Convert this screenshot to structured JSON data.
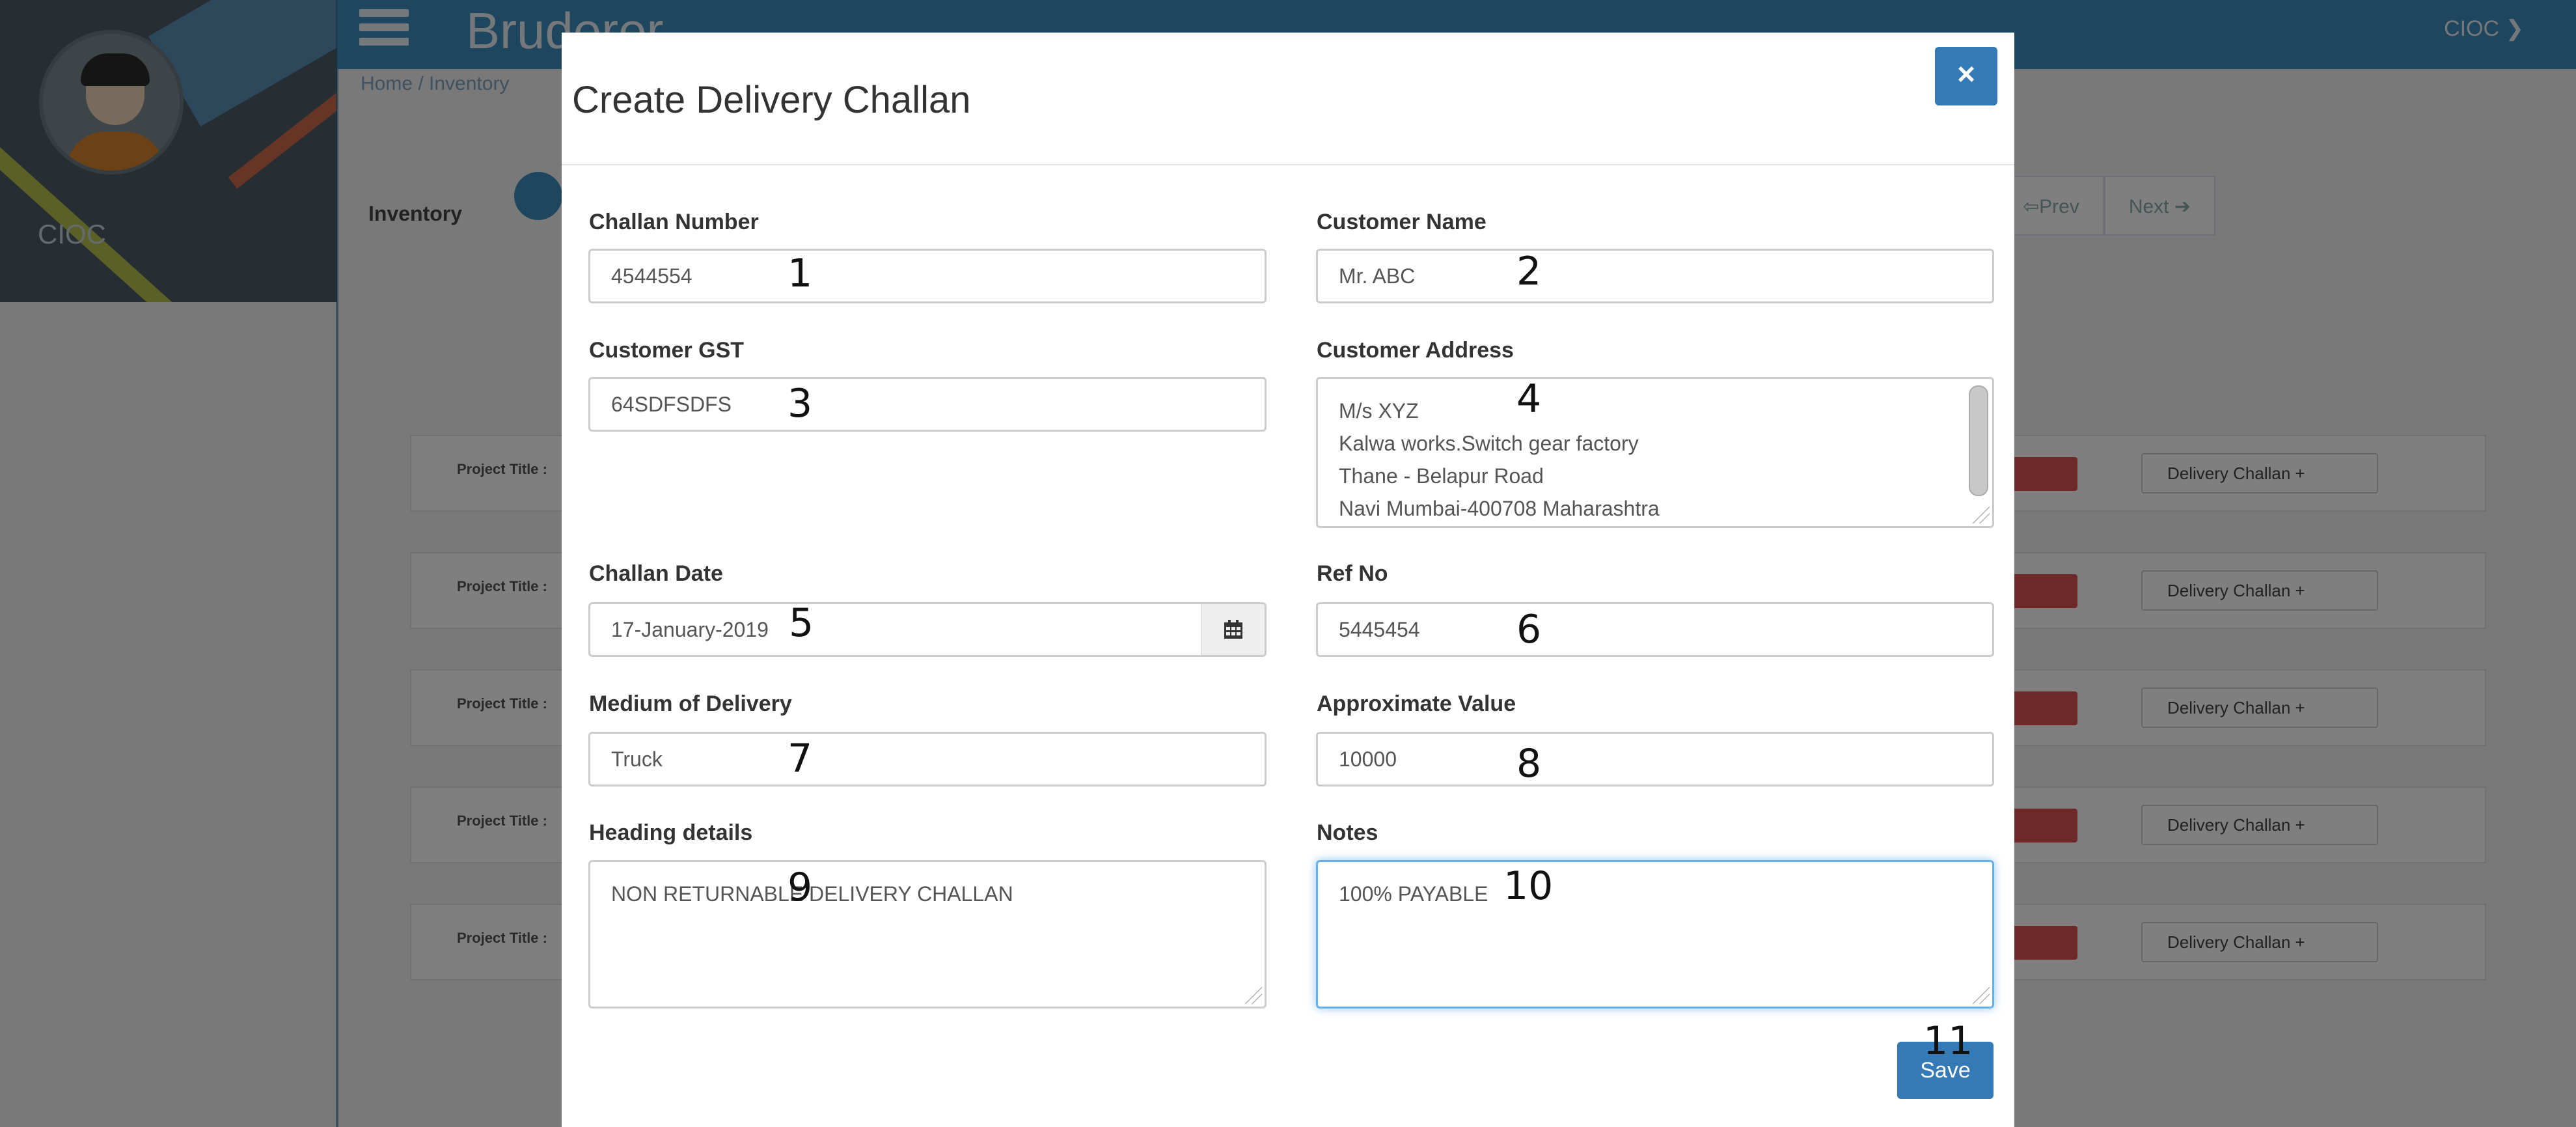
{
  "app": {
    "brand": "Bruderer",
    "user_menu": "CIOC ❯",
    "profile_name": "CIOC",
    "breadcrumb": "Home  /  Inventory",
    "inventory_label": "Inventory",
    "pager": {
      "prev": "⇦Prev",
      "next": "Next ➔"
    },
    "project_cards": [
      {
        "title": "Project Title :",
        "button": "Delivery Challan  +"
      },
      {
        "title": "Project Title :",
        "button": "Delivery Challan  +"
      },
      {
        "title": "Project Title :",
        "button": "Delivery Challan  +"
      },
      {
        "title": "Project Title :",
        "button": "Delivery Challan  +"
      },
      {
        "title": "Project Title :",
        "button": "Delivery Challan  +"
      }
    ]
  },
  "modal": {
    "title": "Create Delivery Challan",
    "close_label": "×",
    "fields": {
      "challan_number": {
        "label": "Challan Number",
        "value": "4544554"
      },
      "customer_name": {
        "label": "Customer Name",
        "value": "Mr. ABC"
      },
      "customer_gst": {
        "label": "Customer GST",
        "value": "64SDFSDFS"
      },
      "customer_address": {
        "label": "Customer Address",
        "lines": [
          "M/s XYZ",
          "Kalwa works.Switch gear factory",
          "Thane - Belapur Road",
          "Navi Mumbai-400708 Maharashtra"
        ]
      },
      "challan_date": {
        "label": "Challan Date",
        "value": "17-January-2019"
      },
      "ref_no": {
        "label": "Ref No",
        "value": "5445454"
      },
      "medium_of_delivery": {
        "label": "Medium of Delivery",
        "value": "Truck"
      },
      "approximate_value": {
        "label": "Approximate Value",
        "value": "10000"
      },
      "heading_details": {
        "label": "Heading details",
        "value": "NON RETURNABLE DELIVERY CHALLAN"
      },
      "notes": {
        "label": "Notes",
        "value": "100% PAYABLE"
      }
    },
    "save_label": "Save"
  },
  "markers": [
    "1",
    "2",
    "3",
    "4",
    "5",
    "6",
    "7",
    "8",
    "9",
    "10",
    "11"
  ]
}
